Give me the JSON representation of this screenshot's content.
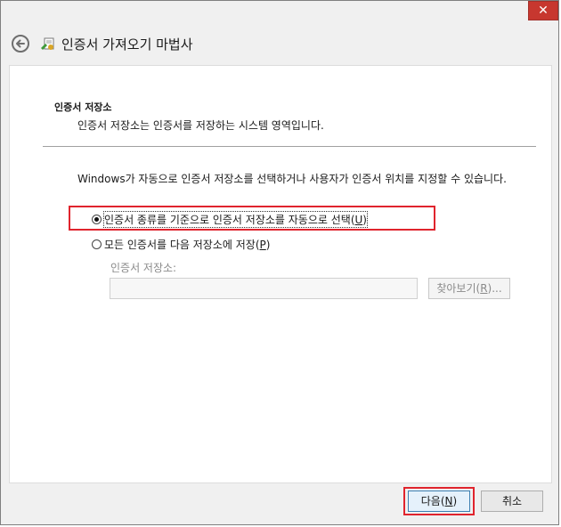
{
  "window": {
    "close_label": "✕"
  },
  "header": {
    "title": "인증서 가져오기 마법사",
    "back_icon": "back-arrow-icon",
    "wizard_icon": "certificate-icon"
  },
  "section": {
    "title": "인증서 저장소",
    "description": "인증서 저장소는 인증서를 저장하는 시스템 영역입니다."
  },
  "instruction": "Windows가 자동으로 인증서 저장소를 선택하거나 사용자가 인증서 위치를 지정할 수 있습니다.",
  "options": [
    {
      "label": "인증서 종류를 기준으로 인증서 저장소를 자동으로 선택",
      "shortcut": "U",
      "checked": true
    },
    {
      "label": "모든 인증서를 다음 저장소에 저장",
      "shortcut": "P",
      "checked": false
    }
  ],
  "store": {
    "label": "인증서 저장소:",
    "value": "",
    "browse_label": "찾아보기",
    "browse_shortcut": "R",
    "browse_suffix": "..."
  },
  "footer": {
    "next_label": "다음",
    "next_shortcut": "N",
    "cancel_label": "취소"
  },
  "colors": {
    "highlight": "#e0242d",
    "close": "#c7372f"
  }
}
